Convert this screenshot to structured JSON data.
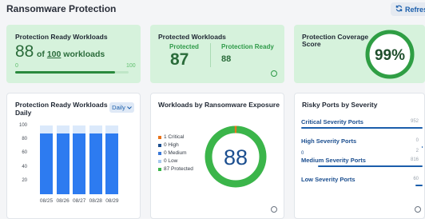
{
  "header": {
    "title": "Ransomware Protection",
    "refresh_label": "Refresh",
    "refresh_icon": "refresh-icon"
  },
  "ready_card": {
    "title": "Protection Ready Workloads",
    "value": "88",
    "of_prefix": "of",
    "total": "100",
    "of_suffix": "workloads",
    "min_label": "0",
    "max_label": "100",
    "progress_fraction": 0.88,
    "accent": "#2a8a3e"
  },
  "protected_card": {
    "title": "Protected Workloads",
    "protected_label": "Protected",
    "protected_value": "87",
    "ready_label": "Protection Ready",
    "ready_value": "88"
  },
  "coverage_card": {
    "title_line1": "Protection Coverage",
    "title_line2": "Score",
    "score": "99%",
    "score_fraction": 0.99
  },
  "daily_card": {
    "title_line1": "Protection Ready Workloads -",
    "title_line2": "Daily",
    "period_label": "Daily"
  },
  "exposure_card": {
    "title": "Workloads by Ransomware Exposure",
    "center_value": "88",
    "legend": [
      {
        "label": "1 Critical",
        "color": "#e8731a"
      },
      {
        "label": "0 High",
        "color": "#1b4e8f"
      },
      {
        "label": "0 Medium",
        "color": "#3a78d8"
      },
      {
        "label": "0 Low",
        "color": "#a9c9ee"
      },
      {
        "label": "87 Protected",
        "color": "#3bb54a"
      }
    ]
  },
  "ports_card": {
    "title": "Risky Ports by Severity",
    "rows": [
      {
        "label": "Critical Severity Ports",
        "value": "952",
        "sub": "",
        "fraction": 1.0
      },
      {
        "label": "High Severity Ports",
        "value": "0",
        "sub": "2",
        "fraction": 0.0
      },
      {
        "label": "Medium Severity Ports",
        "value": "816",
        "sub": "0",
        "fraction": 0.86
      },
      {
        "label": "Low Severity Ports",
        "value": "60",
        "sub": "",
        "fraction": 0.06
      }
    ]
  },
  "chart_data": {
    "type": "bar",
    "categories": [
      "08/25",
      "08/26",
      "08/27",
      "08/28",
      "08/29"
    ],
    "series": [
      {
        "values": [
          88,
          88,
          88,
          88,
          88
        ],
        "color": "#2d7bf0"
      },
      {
        "values": [
          100,
          100,
          100,
          100,
          100
        ],
        "color": "#dbe9fb"
      }
    ],
    "yticks": [
      "100",
      "80",
      "60",
      "40",
      "20"
    ],
    "ylim": [
      0,
      100
    ],
    "xlabel": "",
    "ylabel": "",
    "title": ""
  }
}
